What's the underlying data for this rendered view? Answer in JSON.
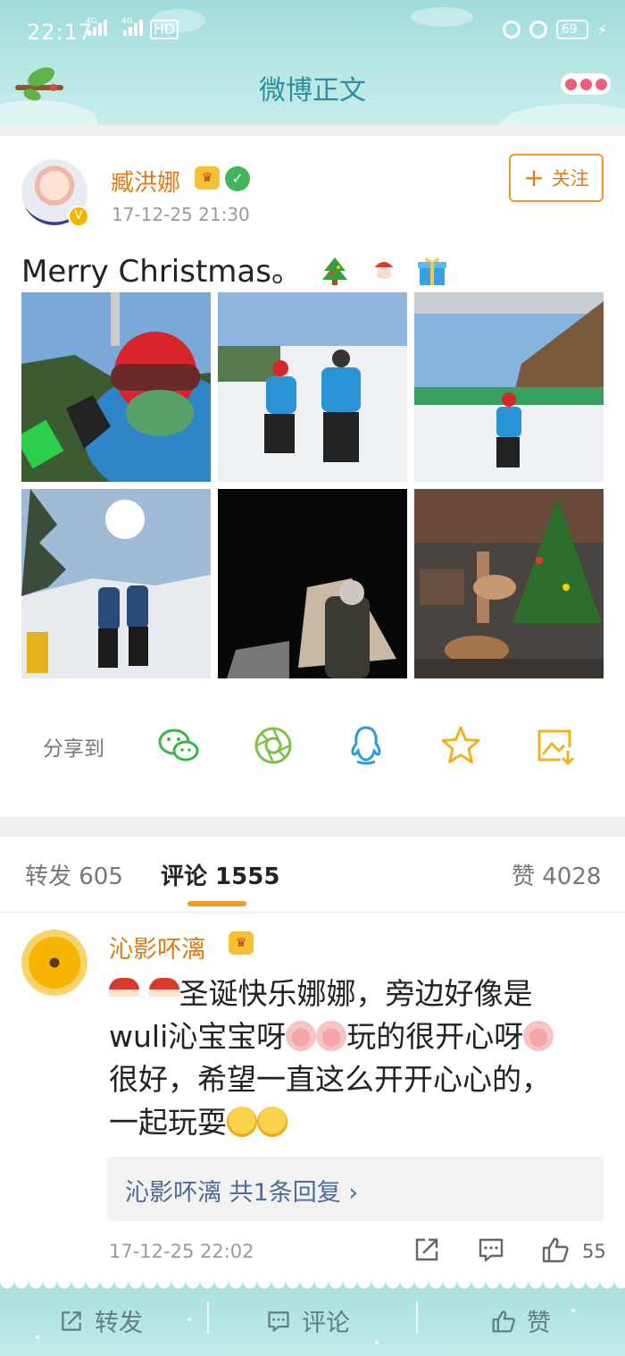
{
  "status_bar": {
    "time": "22:17",
    "network_1": "4G",
    "network_2": "4G",
    "network_3": "HD",
    "battery": "69"
  },
  "header": {
    "title": "微博正文"
  },
  "post": {
    "author": "臧洪娜",
    "timestamp": "17-12-25 21:30",
    "follow_label": "关注",
    "text": "Merry Christmas。",
    "images": [
      "ski-selfie",
      "two-kids-skiing",
      "child-on-slope",
      "backlit-skiers",
      "night-scene",
      "christmas-tree-reindeer"
    ]
  },
  "share": {
    "label": "分享到",
    "targets": [
      "wechat-icon",
      "moments-icon",
      "qq-icon",
      "favorite-star-icon",
      "save-image-icon"
    ]
  },
  "tabs": {
    "repost": "转发 605",
    "comments": "评论 1555",
    "likes": "赞 4028"
  },
  "comment": {
    "author": "沁影吥漓",
    "line1": "圣诞快乐娜娜，旁边好像是",
    "line2a": "wuli沁宝宝呀",
    "line2b": "玩的很开心呀",
    "line3": "很好，希望一直这么开开心心的，",
    "line4": "一起玩耍",
    "reply_summary": "沁影吥漓  共1条回复 ›",
    "timestamp": "17-12-25 22:02",
    "like_count": "55"
  },
  "bottom_bar": {
    "repost": "转发",
    "comment": "评论",
    "like": "赞"
  },
  "colors": {
    "header_bg": "#b8e7e3",
    "title": "#2d8f9c",
    "name": "#e07a14",
    "accent": "#f39b26",
    "link": "#4d6c9b"
  }
}
